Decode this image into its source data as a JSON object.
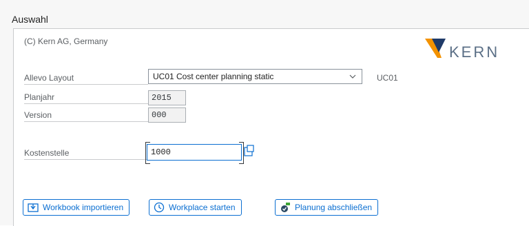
{
  "section_title": "Auswahl",
  "copyright": "(C) Kern AG, Germany",
  "logo_text": "KERN",
  "fields": {
    "layout": {
      "label": "Allevo Layout",
      "value": "UC01 Cost center planning static",
      "code": "UC01"
    },
    "planjahr": {
      "label": "Planjahr",
      "value": "2015"
    },
    "version": {
      "label": "Version",
      "value": "000"
    },
    "kostenstelle": {
      "label": "Kostenstelle",
      "value": "1000"
    }
  },
  "buttons": {
    "import": "Workbook importieren",
    "workplace": "Workplace starten",
    "finish": "Planung abschließen"
  },
  "colors": {
    "accent": "#0a6ed1",
    "logo_orange": "#f39200",
    "logo_blue": "#1f3a68"
  }
}
